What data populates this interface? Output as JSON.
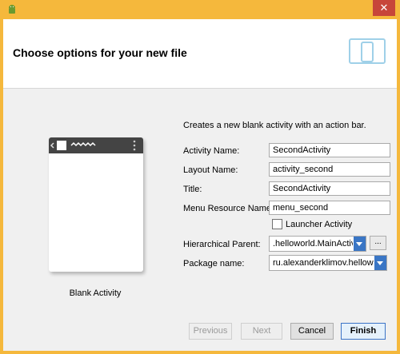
{
  "page": {
    "title": "Choose options for your new file",
    "description": "Creates a new blank activity with an action bar."
  },
  "preview": {
    "caption": "Blank Activity"
  },
  "fields": {
    "activity_name": {
      "label": "Activity Name:",
      "value": "SecondActivity"
    },
    "layout_name": {
      "label": "Layout Name:",
      "value": "activity_second"
    },
    "title": {
      "label": "Title:",
      "value": "SecondActivity"
    },
    "menu_resource_name": {
      "label": "Menu Resource Name:",
      "value": "menu_second"
    }
  },
  "launcher_activity": {
    "label": "Launcher Activity",
    "checked": false
  },
  "hierarchical_parent": {
    "label": "Hierarchical Parent:",
    "value": ".helloworld.MainActivity",
    "browse_label": "..."
  },
  "package_name": {
    "label": "Package name:",
    "value": "ru.alexanderklimov.helloworld"
  },
  "buttons": {
    "previous": "Previous",
    "next": "Next",
    "cancel": "Cancel",
    "finish": "Finish"
  },
  "window": {
    "close_label": "✕"
  },
  "icons": {
    "app": "android-icon",
    "header": "devices-icon",
    "close": "close-icon"
  },
  "colors": {
    "frame": "#f5b83c",
    "accent": "#3a76c5",
    "close": "#c7463a"
  }
}
